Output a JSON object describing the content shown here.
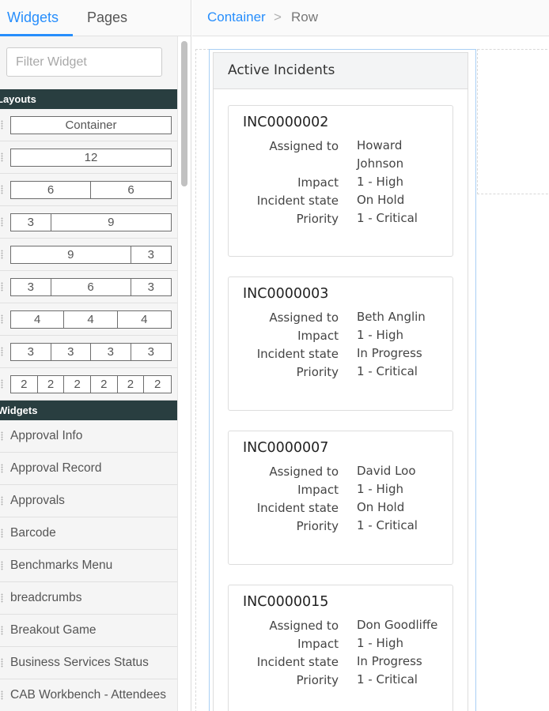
{
  "sidebar": {
    "tabs": {
      "widgets": "Widgets",
      "pages": "Pages"
    },
    "filter": {
      "placeholder": "Filter Widget",
      "value": ""
    },
    "layouts_header": "Layouts",
    "layouts": [
      [
        "Container"
      ],
      [
        "12"
      ],
      [
        "6",
        "6"
      ],
      [
        "3",
        "9"
      ],
      [
        "9",
        "3"
      ],
      [
        "3",
        "6",
        "3"
      ],
      [
        "4",
        "4",
        "4"
      ],
      [
        "3",
        "3",
        "3",
        "3"
      ],
      [
        "2",
        "2",
        "2",
        "2",
        "2",
        "2"
      ]
    ],
    "widgets_header": "Widgets",
    "widgets": [
      "Approval Info",
      "Approval Record",
      "Approvals",
      "Barcode",
      "Benchmarks Menu",
      "breadcrumbs",
      "Breakout Game",
      "Business Services Status",
      "CAB Workbench - Attendees"
    ]
  },
  "breadcrumb": {
    "container": "Container",
    "separator": ">",
    "row": "Row"
  },
  "panel": {
    "title": "Active Incidents",
    "labels": {
      "assigned_to": "Assigned to",
      "impact": "Impact",
      "state": "Incident state",
      "priority": "Priority"
    },
    "incidents": [
      {
        "number": "INC0000002",
        "assigned_to": "Howard Johnson",
        "impact": "1 - High",
        "state": "On Hold",
        "priority": "1 - Critical"
      },
      {
        "number": "INC0000003",
        "assigned_to": "Beth Anglin",
        "impact": "1 - High",
        "state": "In Progress",
        "priority": "1 - Critical"
      },
      {
        "number": "INC0000007",
        "assigned_to": "David Loo",
        "impact": "1 - High",
        "state": "On Hold",
        "priority": "1 - Critical"
      },
      {
        "number": "INC0000015",
        "assigned_to": "Don Goodliffe",
        "impact": "1 - High",
        "state": "In Progress",
        "priority": "1 - Critical"
      }
    ]
  },
  "colors": {
    "accent": "#278efc",
    "section_header": "#293e40",
    "selection_border": "#a9cff5"
  }
}
